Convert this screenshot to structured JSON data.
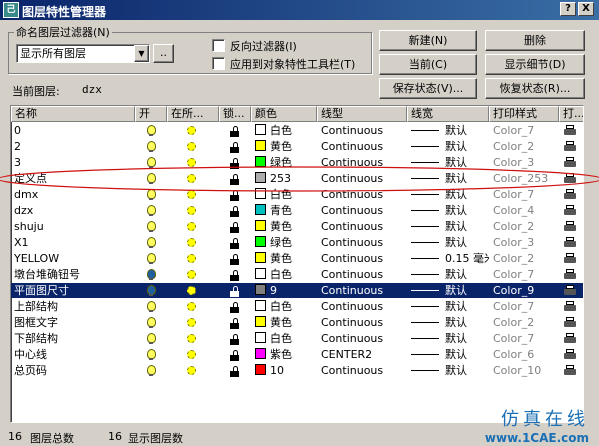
{
  "window": {
    "title": "图层特性管理器",
    "icon_label": "己",
    "help_btn": "?",
    "close_btn": "X"
  },
  "filter": {
    "group_label": "命名图层过滤器(N)",
    "selected": "显示所有图层",
    "dropdown_arrow": "▼",
    "ellipsis": "..",
    "invert_label": "反向过滤器(I)",
    "apply_label": "应用到对象特性工具栏(T)"
  },
  "buttons": {
    "new": "新建(N)",
    "delete": "删除",
    "current": "当前(C)",
    "details": "显示细节(D)",
    "save_state": "保存状态(V)...",
    "restore_state": "恢复状态(R)..."
  },
  "current_layer": {
    "label": "当前图层:",
    "value": "dzx"
  },
  "columns": [
    "名称",
    "开",
    "在所...",
    "锁...",
    "颜色",
    "线型",
    "线宽",
    "打印样式",
    "打..."
  ],
  "layers": [
    {
      "name": "0",
      "on": true,
      "color_name": "白色",
      "color": "#ffffff",
      "linetype": "Continuous",
      "lineweight": "默认",
      "plotstyle": "Color_7"
    },
    {
      "name": "2",
      "on": true,
      "color_name": "黄色",
      "color": "#ffff00",
      "linetype": "Continuous",
      "lineweight": "默认",
      "plotstyle": "Color_2"
    },
    {
      "name": "3",
      "on": true,
      "color_name": "绿色",
      "color": "#00ff00",
      "linetype": "Continuous",
      "lineweight": "默认",
      "plotstyle": "Color_3"
    },
    {
      "name": "定义点",
      "on": true,
      "color_name": "253",
      "color": "#adadad",
      "linetype": "Continuous",
      "lineweight": "默认",
      "plotstyle": "Color_253"
    },
    {
      "name": "dmx",
      "on": true,
      "color_name": "白色",
      "color": "#ffffff",
      "linetype": "Continuous",
      "lineweight": "默认",
      "plotstyle": "Color_7"
    },
    {
      "name": "dzx",
      "on": true,
      "color_name": "青色",
      "color": "#00c0c0",
      "linetype": "Continuous",
      "lineweight": "默认",
      "plotstyle": "Color_4"
    },
    {
      "name": "shuju",
      "on": true,
      "color_name": "黄色",
      "color": "#ffff00",
      "linetype": "Continuous",
      "lineweight": "默认",
      "plotstyle": "Color_2"
    },
    {
      "name": "X1",
      "on": true,
      "color_name": "绿色",
      "color": "#00ff00",
      "linetype": "Continuous",
      "lineweight": "默认",
      "plotstyle": "Color_3"
    },
    {
      "name": "YELLOW",
      "on": true,
      "color_name": "黄色",
      "color": "#ffff00",
      "linetype": "Continuous",
      "lineweight": "0.15 毫米",
      "plotstyle": "Color_2"
    },
    {
      "name": "墩台堆确钮号",
      "on": false,
      "color_name": "白色",
      "color": "#ffffff",
      "linetype": "Continuous",
      "lineweight": "默认",
      "plotstyle": "Color_7"
    },
    {
      "name": "平面图尺寸",
      "on": false,
      "color_name": "9",
      "color": "#808080",
      "linetype": "Continuous",
      "lineweight": "默认",
      "plotstyle": "Color_9",
      "selected": true
    },
    {
      "name": "上部结构",
      "on": true,
      "color_name": "白色",
      "color": "#ffffff",
      "linetype": "Continuous",
      "lineweight": "默认",
      "plotstyle": "Color_7"
    },
    {
      "name": "图框文字",
      "on": true,
      "color_name": "黄色",
      "color": "#ffff00",
      "linetype": "Continuous",
      "lineweight": "默认",
      "plotstyle": "Color_2"
    },
    {
      "name": "下部结构",
      "on": true,
      "color_name": "白色",
      "color": "#ffffff",
      "linetype": "Continuous",
      "lineweight": "默认",
      "plotstyle": "Color_7"
    },
    {
      "name": "中心线",
      "on": true,
      "color_name": "紫色",
      "color": "#ff00ff",
      "linetype": "CENTER2",
      "lineweight": "默认",
      "plotstyle": "Color_6"
    },
    {
      "name": "总页码",
      "on": true,
      "color_name": "10",
      "color": "#ff0000",
      "linetype": "Continuous",
      "lineweight": "默认",
      "plotstyle": "Color_10"
    }
  ],
  "status": {
    "total_count": "16",
    "total_label": "图层总数",
    "shown_count": "16",
    "shown_label": "显示图层数"
  },
  "watermark": {
    "title": "仿真在线",
    "url": "www.1CAE.com"
  }
}
